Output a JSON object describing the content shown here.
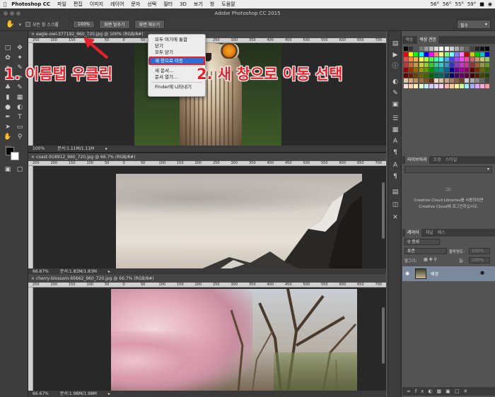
{
  "menubar": {
    "apple": "",
    "app_name": "Photoshop CC",
    "items": [
      "파일",
      "편집",
      "이미지",
      "레이어",
      "문자",
      "선택",
      "필터",
      "3D",
      "보기",
      "창",
      "도움말"
    ],
    "status": [
      "56°",
      "56°",
      "55°",
      "59°"
    ]
  },
  "window_title": "Adobe Photoshop CC 2015",
  "options_bar": {
    "scroll_all_label": "모든 창 스크롤",
    "zoom_100": "100%",
    "fit_screen": "화면 맞추기",
    "fill_screen": "화면 채우기",
    "workspace": "필수"
  },
  "documents": [
    {
      "tab_title": "eagle-owl-377192_960_720.jpg @ 100% (RGB/8#)",
      "zoom": "100%",
      "doc_info": "문서:1.11M/1.11M"
    },
    {
      "tab_title": "coast-918912_960_720.jpg @ 66.7% (RGB/8#)",
      "zoom": "66.67%",
      "doc_info": "문서:1.83M/1.83M"
    },
    {
      "tab_title": "cherry-blossom-95662_960_720.jpg @ 66.7% (RGB/8#)",
      "zoom": "66.67%",
      "doc_info": "문서:1.98M/1.98M"
    }
  ],
  "ruler_ticks": [
    "250",
    "200",
    "150",
    "100",
    "50",
    "0",
    "50",
    "100",
    "150",
    "200",
    "250",
    "300",
    "350",
    "400",
    "450",
    "500",
    "550",
    "600",
    "650",
    "700"
  ],
  "context_menu": {
    "items": [
      "모두 여기에 통합",
      "닫기",
      "모두 닫기",
      "새 창으로 이동",
      "새 문서...",
      "문서 열기...",
      "Finder에 나타내기"
    ],
    "selected_index": 3
  },
  "annotations": {
    "step1": "1. 이름탭 우클릭",
    "step2": "2. 새 창으로 이동 선택",
    "color": "#e8202a"
  },
  "panels": {
    "color_tabs": [
      "색상",
      "색상 견본"
    ],
    "library_tabs": [
      "라이브러리",
      "조정",
      "스타일"
    ],
    "cc_text_1": "Creative Cloud Libraries를 사용하려면",
    "cc_text_2": "Creative Cloud에 로그인하십시오.",
    "layer_tabs": [
      "레이어",
      "채널",
      "패스"
    ],
    "kind_label": "종류",
    "blend_mode": "표준",
    "opacity_label": "불투명도:",
    "opacity_value": "100%",
    "lock_label": "잠그기:",
    "fill_label": "칠:",
    "fill_value": "100%",
    "layer_name": "배경"
  }
}
